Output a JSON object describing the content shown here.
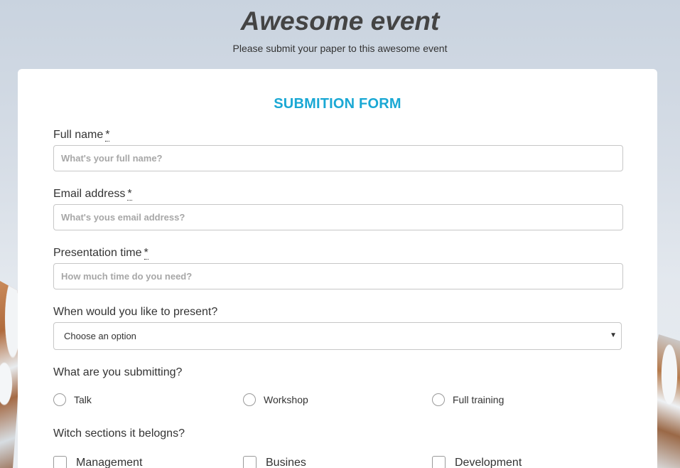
{
  "header": {
    "title": "Awesome event",
    "subtitle": "Please submit your paper to this awesome event"
  },
  "form": {
    "heading": "SUBMITION FORM",
    "required_marker": "*",
    "fields": [
      {
        "label": "Full name",
        "placeholder": "What's your full name?",
        "value": ""
      },
      {
        "label": "Email address",
        "placeholder": "What's yous email address?",
        "value": ""
      },
      {
        "label": "Presentation time",
        "placeholder": "How much time do you need?",
        "value": ""
      }
    ],
    "present_when": {
      "label": "When would you like to present?",
      "selected": "Choose an option"
    },
    "submission_type": {
      "label": "What are you submitting?",
      "options": [
        "Talk",
        "Workshop",
        "Full training"
      ]
    },
    "sections": {
      "label": "Witch sections it belogns?",
      "options": [
        "Management",
        "Busines",
        "Development"
      ]
    }
  }
}
